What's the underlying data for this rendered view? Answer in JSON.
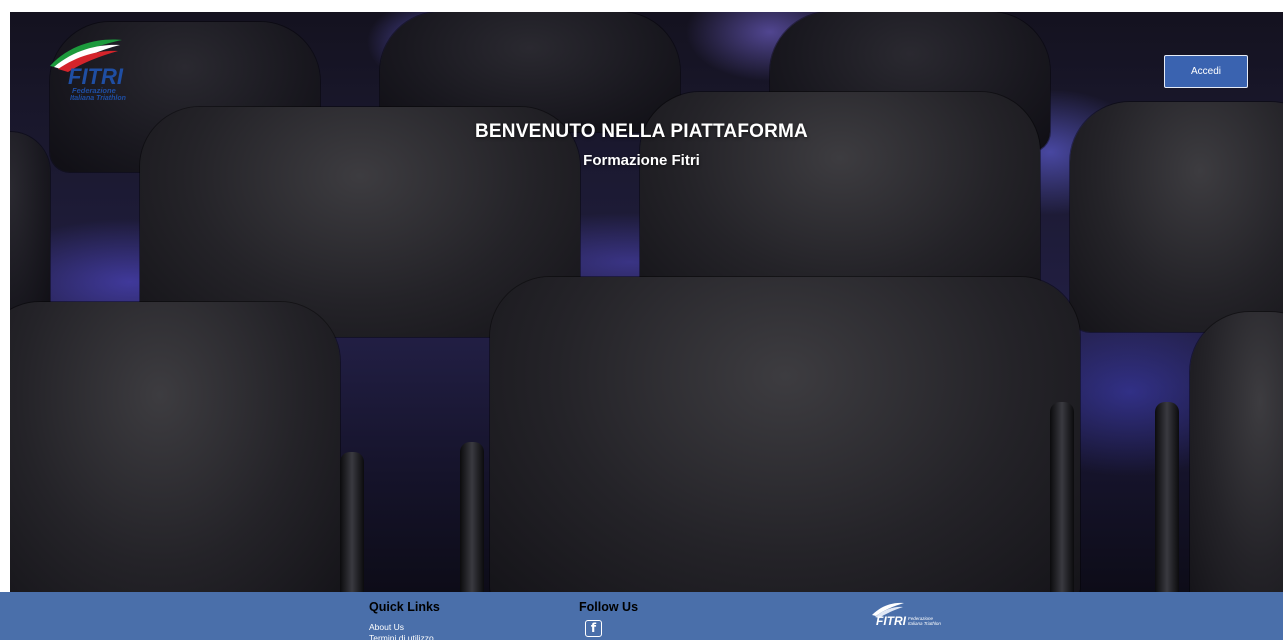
{
  "header": {
    "logo": {
      "icon": "fitri-logo",
      "text_main": "FITRI",
      "text_line1": "Federazione",
      "text_line2": "Italiana Triathlon"
    },
    "login_label": "Accedi"
  },
  "hero": {
    "title": "BENVENUTO NELLA PIATTAFORMA",
    "subtitle": "Formazione Fitri"
  },
  "footer": {
    "quick_links_title": "Quick Links",
    "links": [
      "About Us",
      "Termini di utilizzo"
    ],
    "follow_title": "Follow Us",
    "social_icon": "facebook-icon",
    "social_glyph": "f",
    "logo": {
      "text_main": "FITRI",
      "text_line1": "Federazione",
      "text_line2": "Italiana Triathlon"
    }
  },
  "colors": {
    "footer_bg": "#4a6faa",
    "button_bg": "#3a63b0",
    "hero_light": "#5a4fe0"
  }
}
